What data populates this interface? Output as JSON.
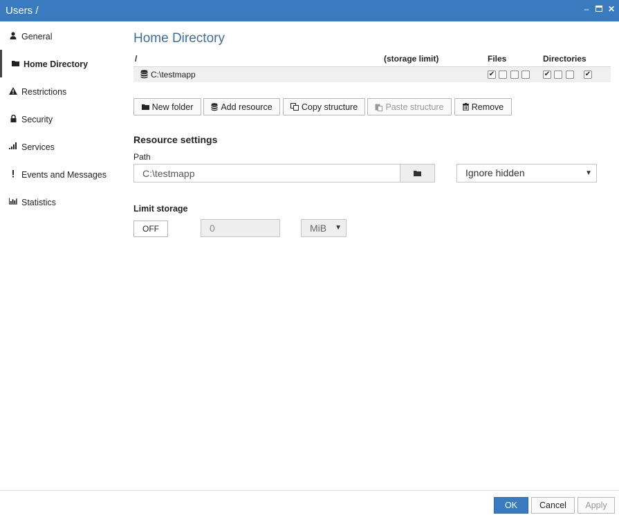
{
  "window": {
    "title": "Users /"
  },
  "sidebar": {
    "items": [
      {
        "label": "General",
        "icon": "user-icon"
      },
      {
        "label": "Home Directory",
        "icon": "folder-icon"
      },
      {
        "label": "Restrictions",
        "icon": "warning-icon"
      },
      {
        "label": "Security",
        "icon": "lock-icon"
      },
      {
        "label": "Services",
        "icon": "signal-icon"
      },
      {
        "label": "Events and Messages",
        "icon": "exclamation-icon"
      },
      {
        "label": "Statistics",
        "icon": "bar-chart-icon"
      }
    ],
    "active": "Home Directory"
  },
  "main": {
    "title": "Home Directory",
    "table": {
      "headers": {
        "path": "/",
        "storage": "(storage limit)",
        "files": "Files",
        "directories": "Directories"
      },
      "row": {
        "path": "C:\\testmapp",
        "files_permissions": [
          true,
          false,
          false,
          false
        ],
        "dir_permissions": [
          true,
          false,
          false,
          true
        ]
      }
    },
    "toolbar": {
      "new_folder": "New folder",
      "add_resource": "Add resource",
      "copy_structure": "Copy structure",
      "paste_structure": "Paste structure",
      "remove": "Remove"
    },
    "resource_settings": {
      "title": "Resource settings",
      "path_label": "Path",
      "path_value": "C:\\testmapp",
      "hidden_option": "Ignore hidden"
    },
    "limit_storage": {
      "label": "Limit storage",
      "toggle": "OFF",
      "size": "0",
      "unit": "MiB"
    }
  },
  "footer": {
    "ok": "OK",
    "cancel": "Cancel",
    "apply": "Apply"
  },
  "colors": {
    "titlebar": "#3a7bbf",
    "heading": "#3f6e9a",
    "ok_button": "#3a7bbf"
  }
}
